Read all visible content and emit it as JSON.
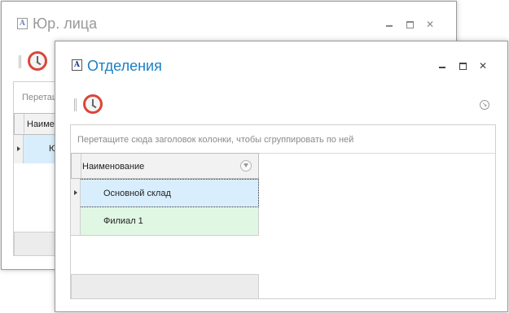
{
  "back_window": {
    "title": "Юр. лица",
    "group_hint": "Перетащ",
    "grid": {
      "header_label": "Наимен",
      "row_text": "Ю"
    }
  },
  "front_window": {
    "title": "Отделения",
    "group_hint": "Перетащите сюда заголовок колонки, чтобы сгруппировать по ней",
    "grid": {
      "header_label": "Наименование",
      "rows": [
        {
          "name": "Основной склад",
          "color": "#d9eefc"
        },
        {
          "name": "Филиал 1",
          "color": "#e0f7e3"
        }
      ]
    }
  },
  "icons": {
    "app": "app-document-icon",
    "toolbar": "clock-icon",
    "minimize": "minimize-icon",
    "maximize": "maximize-icon",
    "close": "close-icon",
    "filter": "filter-icon",
    "row_indicator": "row-indicator-arrow-icon",
    "collapse": "collapse-arrow-icon"
  },
  "colors": {
    "title_active": "#1b7fc4",
    "title_inactive": "#9a9a9a"
  }
}
